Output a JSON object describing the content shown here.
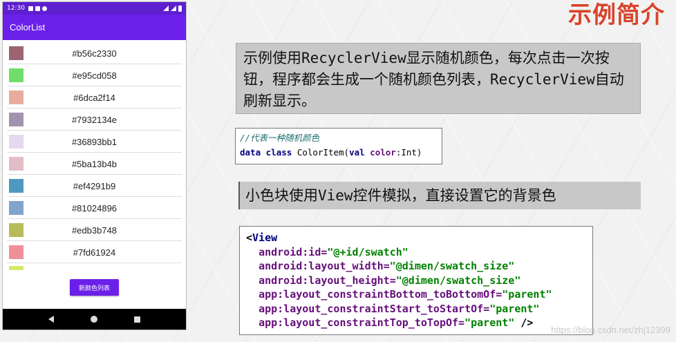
{
  "slide": {
    "title": "示例简介",
    "description": "示例使用RecyclerView显示随机颜色，每次点击一次按钮，程序都会生成一个随机颜色列表，RecyclerView自动刷新显示。",
    "note": "小色块使用View控件模拟，直接设置它的背景色",
    "watermark": "https://blog.csdn.net/zhj12399"
  },
  "code1": {
    "comment": "//代表一种随机颜色",
    "kw_data": "data",
    "kw_class": "class",
    "name": "ColorItem(",
    "kw_val": "val",
    "param": "color",
    "rest": ":Int)"
  },
  "code2": {
    "open_bracket": "<",
    "tag": "View",
    "lines": [
      {
        "attr": "android:id=",
        "val": "\"@+id/swatch\"",
        "tail": ""
      },
      {
        "attr": "android:layout_width=",
        "val": "\"@dimen/swatch_size\"",
        "tail": ""
      },
      {
        "attr": "android:layout_height=",
        "val": "\"@dimen/swatch_size\"",
        "tail": ""
      },
      {
        "attr": "app:layout_constraintBottom_toBottomOf=",
        "val": "\"parent\"",
        "tail": ""
      },
      {
        "attr": "app:layout_constraintStart_toStartOf=",
        "val": "\"parent\"",
        "tail": ""
      },
      {
        "attr": "app:layout_constraintTop_toTopOf=",
        "val": "\"parent\"",
        "tail": " />"
      }
    ]
  },
  "phone": {
    "status_time": "12:30",
    "app_title": "ColorList",
    "button_label": "新颜色列表",
    "colors": [
      {
        "hex": "#b56c2330",
        "swatch": "#9c6370"
      },
      {
        "hex": "#e95cd058",
        "swatch": "#6fdd6a"
      },
      {
        "hex": "#6dca2f14",
        "swatch": "#e8ab9e"
      },
      {
        "hex": "#7932134e",
        "swatch": "#a393b0"
      },
      {
        "hex": "#36893bb1",
        "swatch": "#e5d8ef"
      },
      {
        "hex": "#5ba13b4b",
        "swatch": "#e3bdc6"
      },
      {
        "hex": "#ef4291b9",
        "swatch": "#4f98bf"
      },
      {
        "hex": "#81024896",
        "swatch": "#82a3cc"
      },
      {
        "hex": "#edb3b748",
        "swatch": "#b7bc58"
      },
      {
        "hex": "#7fd61924",
        "swatch": "#ef8f98"
      }
    ],
    "partial_swatch": "#d9e868"
  }
}
